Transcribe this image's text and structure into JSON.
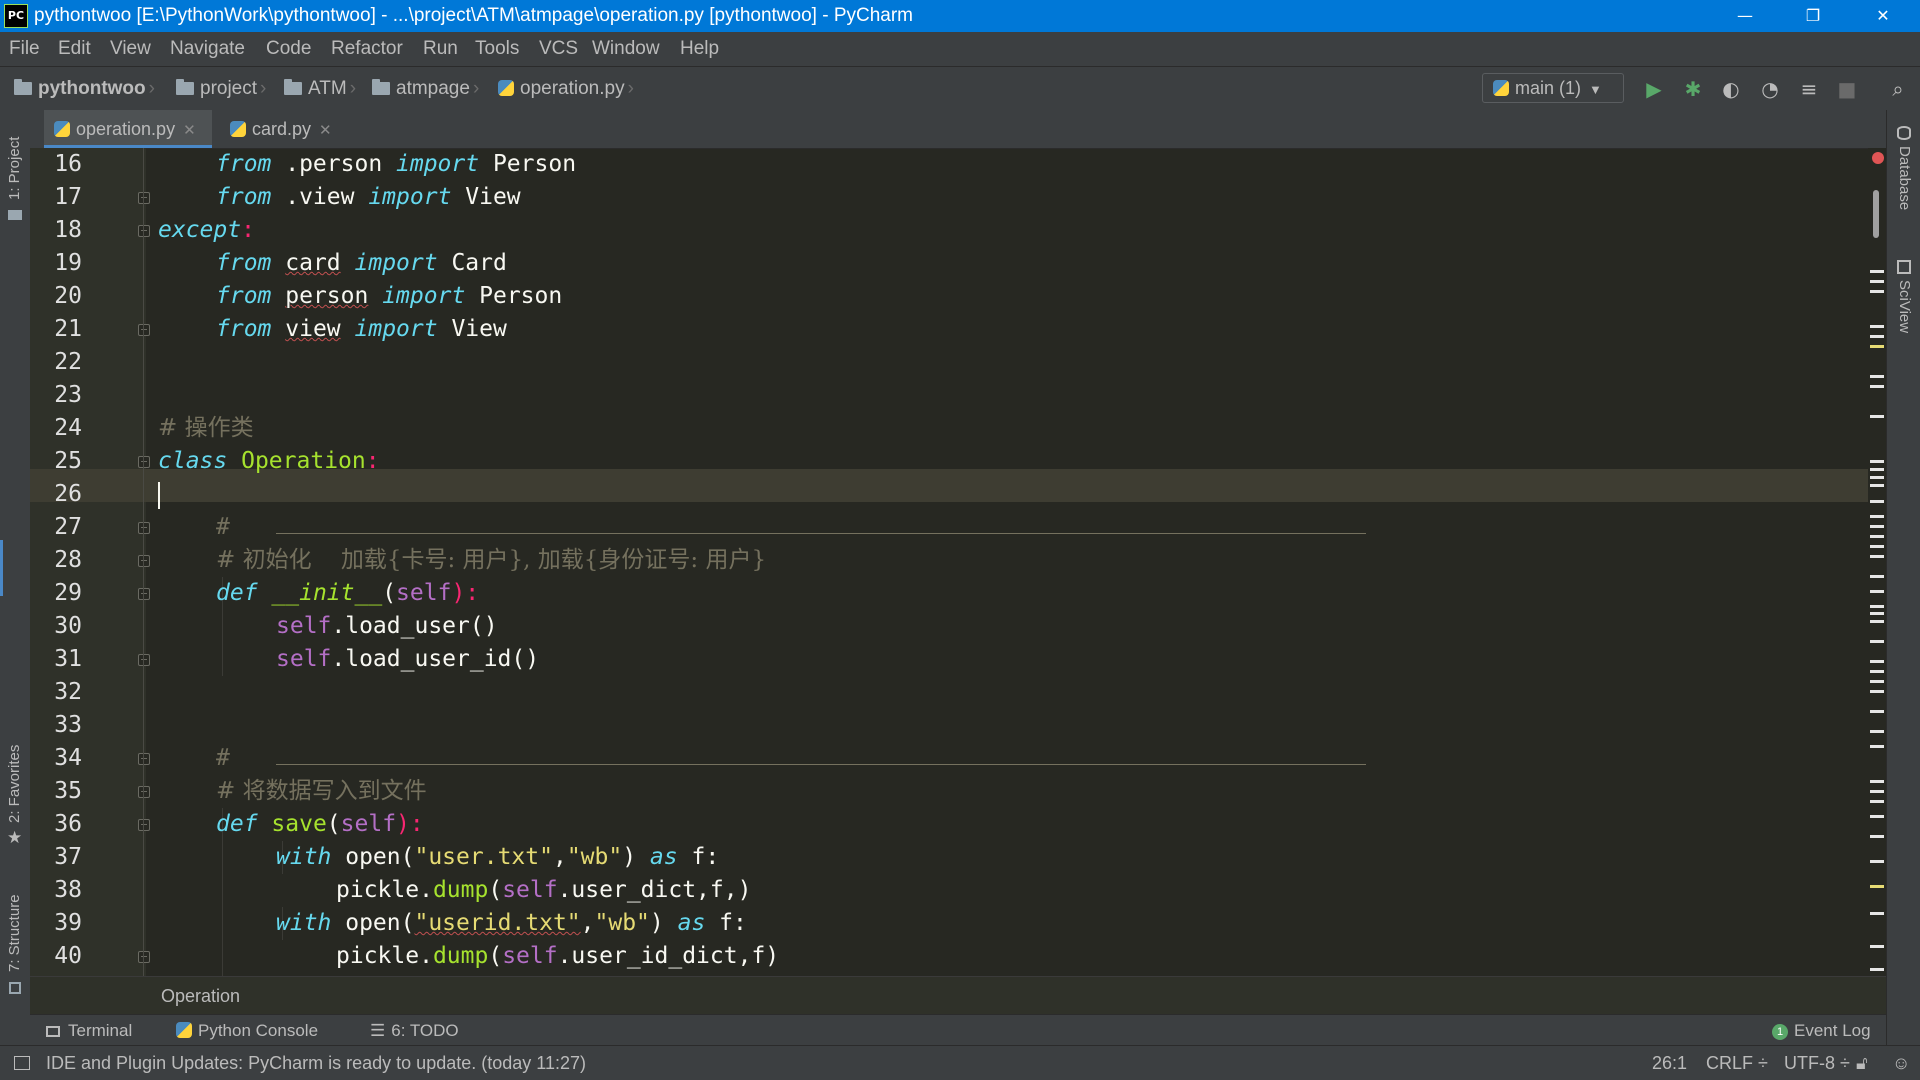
{
  "window": {
    "title": "pythontwoo [E:\\PythonWork\\pythontwoo] - ...\\project\\ATM\\atmpage\\operation.py [pythontwoo] - PyCharm",
    "app_icon": "PC",
    "minimize": "—",
    "restore": "❐",
    "close": "✕"
  },
  "menu": [
    "File",
    "Edit",
    "View",
    "Navigate",
    "Code",
    "Refactor",
    "Run",
    "Tools",
    "VCS",
    "Window",
    "Help"
  ],
  "breadcrumb": {
    "project": "pythontwoo",
    "items": [
      "project",
      "ATM",
      "atmpage",
      "operation.py"
    ]
  },
  "run_config": {
    "label": "main (1)"
  },
  "tabs": [
    {
      "label": "operation.py",
      "active": true
    },
    {
      "label": "card.py",
      "active": false
    }
  ],
  "left_strip": {
    "project": "1: Project",
    "favorites": "2: Favorites",
    "structure": "7: Structure"
  },
  "right_strip": {
    "database": "Database",
    "sciview": "SciView"
  },
  "editor": {
    "lines": [
      {
        "n": "16"
      },
      {
        "n": "17"
      },
      {
        "n": "18"
      },
      {
        "n": "19"
      },
      {
        "n": "20"
      },
      {
        "n": "21"
      },
      {
        "n": "22"
      },
      {
        "n": "23"
      },
      {
        "n": "24"
      },
      {
        "n": "25"
      },
      {
        "n": "26"
      },
      {
        "n": "27"
      },
      {
        "n": "28"
      },
      {
        "n": "29"
      },
      {
        "n": "30"
      },
      {
        "n": "31"
      },
      {
        "n": "32"
      },
      {
        "n": "33"
      },
      {
        "n": "34"
      },
      {
        "n": "35"
      },
      {
        "n": "36"
      },
      {
        "n": "37"
      },
      {
        "n": "38"
      },
      {
        "n": "39"
      },
      {
        "n": "40"
      }
    ],
    "code": {
      "l16": [
        "from",
        " .person ",
        "import",
        " Person"
      ],
      "l17": [
        "from",
        " .view ",
        "import",
        " View"
      ],
      "l18": [
        "except",
        ":"
      ],
      "l19": [
        "from",
        " ",
        "card",
        " ",
        "import",
        " Card"
      ],
      "l20": [
        "from",
        " ",
        "person",
        " ",
        "import",
        " Person"
      ],
      "l21": [
        "from",
        " ",
        "view",
        " ",
        "import",
        " View"
      ],
      "l24": "# 操作类",
      "l25": [
        "class",
        " ",
        "Operation",
        ":"
      ],
      "l27": "# ",
      "l28": "# 初始化    加载{卡号: 用户}, 加载{身份证号: 用户}",
      "l29": [
        "def",
        " ",
        "__init__",
        "(",
        "self",
        "):"
      ],
      "l30": [
        "self",
        ".load_user()"
      ],
      "l31": [
        "self",
        ".load_user_id()"
      ],
      "l34": "# ",
      "l35": "# 将数据写入到文件",
      "l36": [
        "def",
        " ",
        "save",
        "(",
        "self",
        "):"
      ],
      "l37": [
        "with",
        " open(",
        "\"user.txt\"",
        ",",
        "\"wb\"",
        ") ",
        "as",
        " f:"
      ],
      "l38": [
        "pickle.",
        "dump",
        "(",
        "self",
        ".user_dict,f,)"
      ],
      "l39": [
        "with",
        " open(",
        "\"userid.txt\"",
        ",",
        "\"wb\"",
        ") ",
        "as",
        " f:"
      ],
      "l40": [
        "pickle.",
        "dump",
        "(",
        "self",
        ".user_id_dict,f)"
      ]
    }
  },
  "editor_breadcrumb": "Operation",
  "bottom_tabs": {
    "terminal": "Terminal",
    "python_console": "Python Console",
    "todo": "6: TODO",
    "event_log": "Event Log",
    "event_count": "1"
  },
  "status": {
    "message": "IDE and Plugin Updates: PyCharm is ready to update. (today 11:27)",
    "position": "26:1",
    "line_sep": "CRLF ÷",
    "encoding": "UTF-8 ÷"
  },
  "colors": {
    "titlebar": "#0078d7",
    "editor_bg": "#272822",
    "keyword": "#66d9ef",
    "class": "#a6e22e",
    "string": "#e6db74",
    "comment": "#75715e"
  }
}
